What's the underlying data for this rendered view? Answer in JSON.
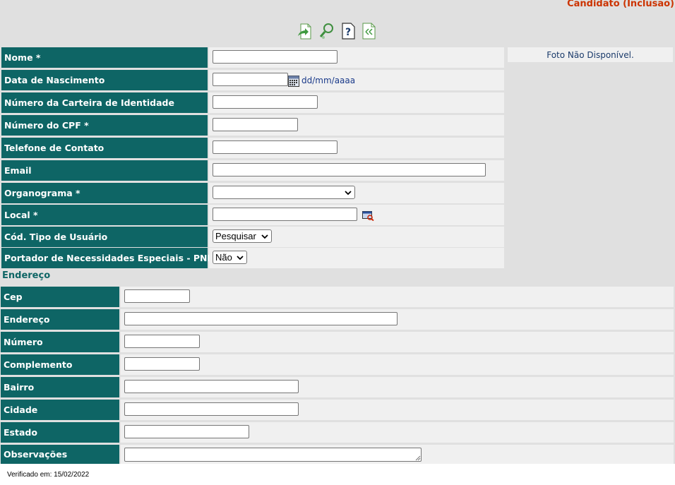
{
  "header": {
    "title": "Candidato (Inclusão)"
  },
  "toolbar": {
    "icons": [
      "save-icon",
      "search-icon",
      "help-icon",
      "list-icon"
    ]
  },
  "photo": {
    "text": "Foto Não Disponível."
  },
  "form": {
    "nome": {
      "label": "Nome *",
      "value": ""
    },
    "nascimento": {
      "label": "Data de Nascimento",
      "value": "",
      "hint": "dd/mm/aaaa"
    },
    "identidade": {
      "label": "Número da Carteira de Identidade",
      "value": ""
    },
    "cpf": {
      "label": "Número do CPF *",
      "value": ""
    },
    "telefone": {
      "label": "Telefone de Contato",
      "value": ""
    },
    "email": {
      "label": "Email",
      "value": ""
    },
    "organograma": {
      "label": "Organograma *",
      "selected": ""
    },
    "local": {
      "label": "Local *",
      "value": ""
    },
    "tipo_usuario": {
      "label": "Cód. Tipo de Usuário",
      "selected": "Pesquisar"
    },
    "pne": {
      "label": "Portador de Necessidades Especiais - PNE? *",
      "selected": "Não"
    }
  },
  "endereco": {
    "section_title": "Endereço",
    "cep": {
      "label": "Cep",
      "value": ""
    },
    "endereco": {
      "label": "Endereço",
      "value": ""
    },
    "numero": {
      "label": "Número",
      "value": ""
    },
    "complemento": {
      "label": "Complemento",
      "value": ""
    },
    "bairro": {
      "label": "Bairro",
      "value": ""
    },
    "cidade": {
      "label": "Cidade",
      "value": ""
    },
    "estado": {
      "label": "Estado",
      "value": ""
    },
    "observacoes": {
      "label": "Observações",
      "value": ""
    }
  },
  "footer": {
    "verified": "Verificado em: 15/02/2022"
  },
  "colors": {
    "label_bg": "#0e6565",
    "title": "#cc3300",
    "field_bg": "#f0f0f0",
    "page_bg": "#e0e0e0"
  }
}
